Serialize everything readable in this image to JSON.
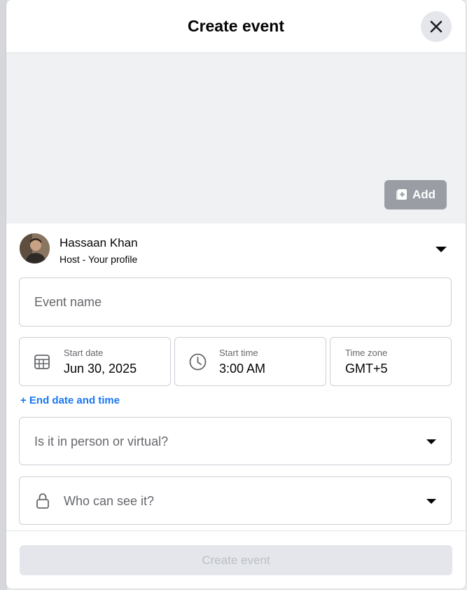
{
  "dialog": {
    "title": "Create event",
    "close_icon": "close-icon"
  },
  "cover": {
    "add_label": "Add",
    "add_icon": "add-photo-icon"
  },
  "host": {
    "name": "Hassaan Khan",
    "subtitle": "Host - Your profile"
  },
  "form": {
    "event_name_placeholder": "Event name",
    "start_date": {
      "label": "Start date",
      "value": "Jun 30, 2025",
      "icon": "calendar-icon"
    },
    "start_time": {
      "label": "Start time",
      "value": "3:00 AM",
      "icon": "clock-icon"
    },
    "time_zone": {
      "label": "Time zone",
      "value": "GMT+5"
    },
    "end_date_link": "+ End date and time",
    "location_placeholder": "Is it in person or virtual?",
    "privacy_placeholder": "Who can see it?",
    "privacy_icon": "lock-icon"
  },
  "footer": {
    "create_label": "Create event"
  },
  "colors": {
    "accent": "#1877f2",
    "disabled_button": "#e4e6eb",
    "add_button": "#9a9ea4"
  }
}
